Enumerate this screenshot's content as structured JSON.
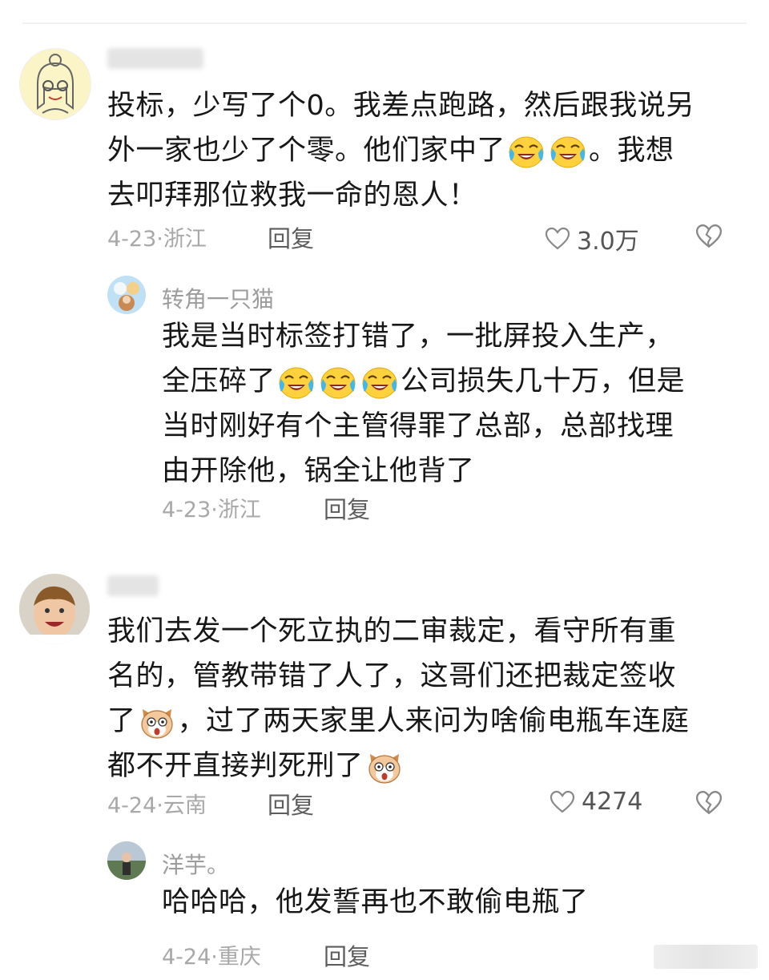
{
  "comments": [
    {
      "username": "",
      "lines": [
        "投标，少写了个0。我差点跑路，然后跟我说另",
        "外一家也少了个零。他们家中了",
        "。我想",
        "去叩拜那位救我一命的恩人！"
      ],
      "date_location": "4-23·浙江",
      "reply_label": "回复",
      "likes": "3.0万",
      "reply": {
        "username": "转角一只猫",
        "lines": [
          "我是当时标签打错了，一批屏投入生产，",
          "全压碎了",
          "公司损失几十万，但是",
          "当时刚好有个主管得罪了总部，总部找理",
          "由开除他，锅全让他背了"
        ],
        "date_location": "4-23·浙江",
        "reply_label": "回复"
      }
    },
    {
      "username": "",
      "lines": [
        "我们去发一个死立执的二审裁定，看守所有重",
        "名的，管教带错了人了，这哥们还把裁定签收",
        "了",
        "，过了两天家里人来问为啥偷电瓶车连庭",
        "都不开直接判死刑了"
      ],
      "date_location": "4-24·云南",
      "reply_label": "回复",
      "likes": "4274",
      "reply": {
        "username": "洋芋。",
        "lines": [
          "哈哈哈，他发誓再也不敢偷电瓶了"
        ],
        "date_location": "4-24·重庆",
        "reply_label": "回复"
      }
    }
  ],
  "icons": {
    "like": "heart-outline-icon",
    "dislike": "broken-heart-icon",
    "emoji_cry": "laugh-cry-emoji",
    "emoji_dog": "shocked-dog-emoji"
  }
}
